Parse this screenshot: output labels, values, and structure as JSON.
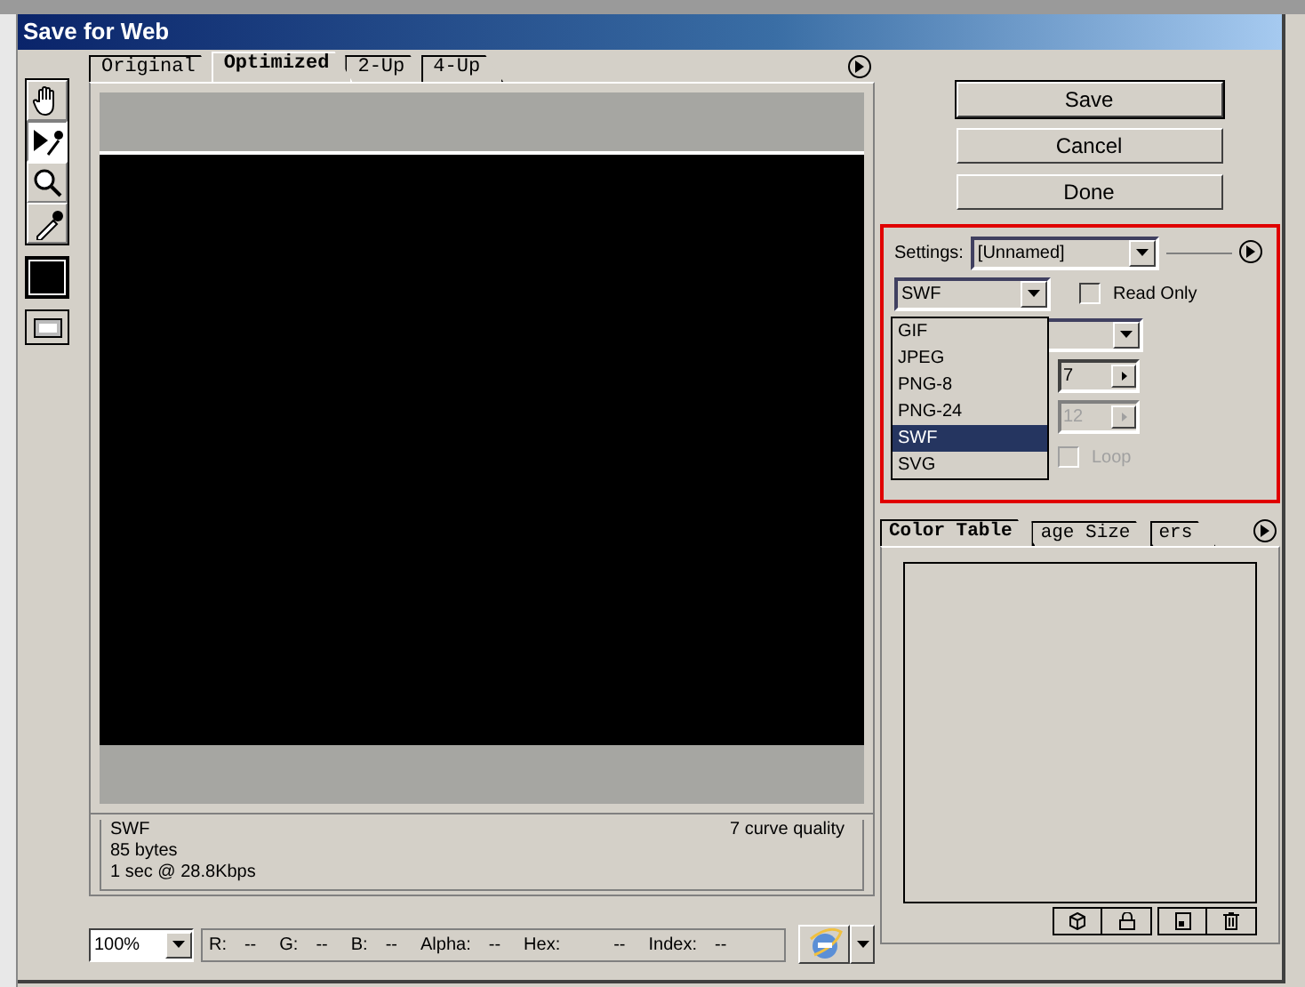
{
  "window": {
    "title": "Save for Web"
  },
  "tools": [
    {
      "kind": "hand",
      "selected": false
    },
    {
      "kind": "slice-select",
      "selected": true
    },
    {
      "kind": "zoom",
      "selected": false
    },
    {
      "kind": "eyedropper",
      "selected": false
    }
  ],
  "view_tabs": [
    {
      "label": "Original",
      "selected": false
    },
    {
      "label": "Optimized",
      "selected": true
    },
    {
      "label": "2-Up",
      "selected": false
    },
    {
      "label": "4-Up",
      "selected": false
    }
  ],
  "preview_info": {
    "format": "SWF",
    "size": "85 bytes",
    "download_time": "1 sec @ 28.8Kbps",
    "quality": "7 curve quality"
  },
  "zoom": {
    "value": "100%"
  },
  "pixel_info": [
    {
      "label": "R:",
      "value": "--"
    },
    {
      "label": "G:",
      "value": "--"
    },
    {
      "label": "B:",
      "value": "--"
    },
    {
      "label": "Alpha:",
      "value": "--"
    },
    {
      "label": "Hex:",
      "value": "--"
    },
    {
      "label": "Index:",
      "value": "--"
    }
  ],
  "buttons": [
    "Save",
    "Cancel",
    "Done"
  ],
  "settings": {
    "label": "Settings:",
    "preset": "[Unnamed]",
    "format": "SWF",
    "read_only": {
      "label": "Read Only",
      "checked": false
    },
    "format_menu": [
      {
        "label": "GIF",
        "selected": false
      },
      {
        "label": "JPEG",
        "selected": false
      },
      {
        "label": "PNG-8",
        "selected": false
      },
      {
        "label": "PNG-24",
        "selected": false
      },
      {
        "label": "SWF",
        "selected": true
      },
      {
        "label": "SVG",
        "selected": false
      }
    ],
    "curve_quality": {
      "value": "7",
      "disabled": false
    },
    "frame_rate": {
      "value": "12",
      "disabled": true
    },
    "loop": {
      "label": "Loop",
      "checked": false,
      "disabled": true
    }
  },
  "panel_tabs": [
    {
      "label": "Color Table",
      "selected": true
    },
    {
      "label": "age Size",
      "selected": false
    },
    {
      "label": "ers",
      "selected": false
    }
  ]
}
